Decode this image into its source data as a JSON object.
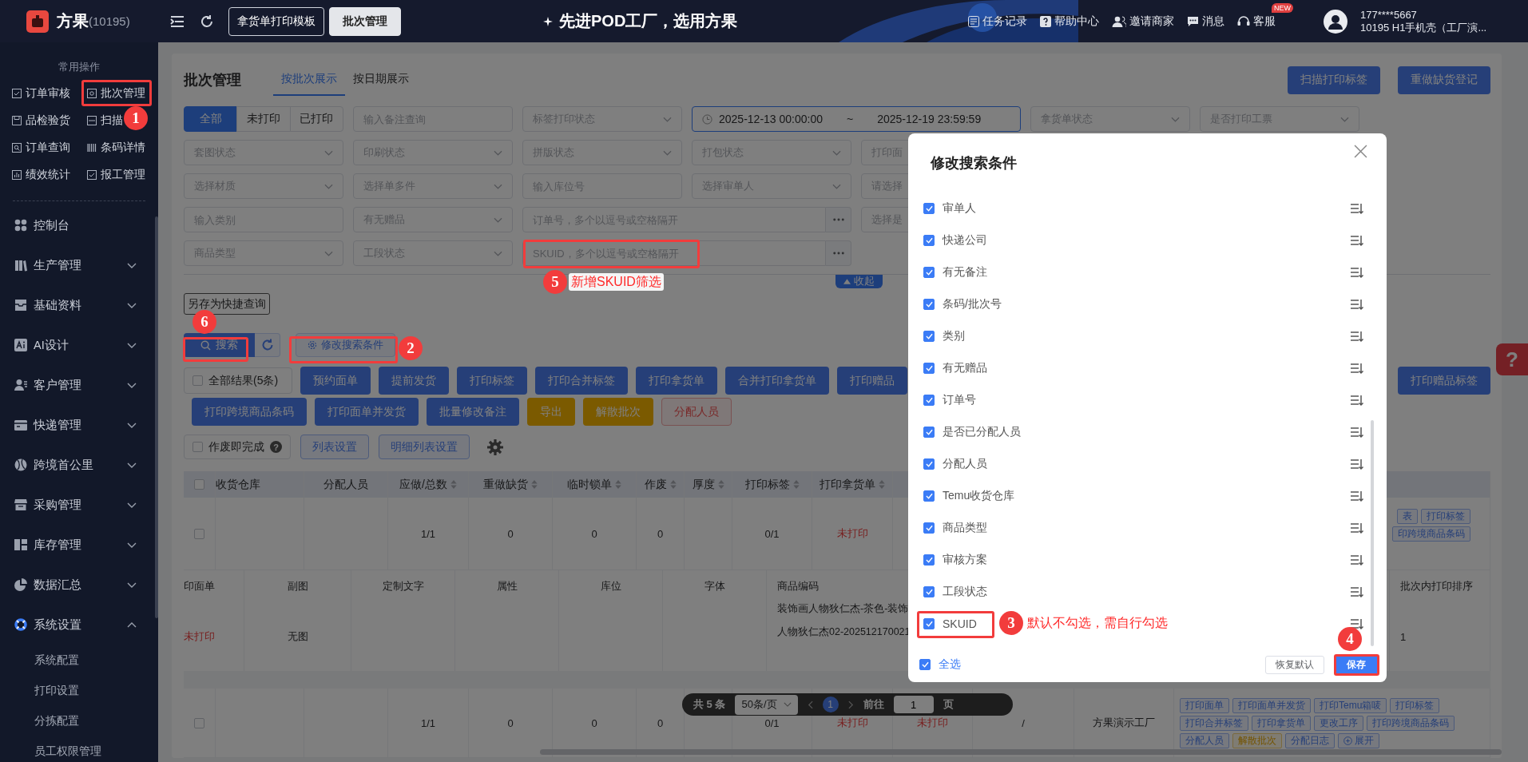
{
  "topbar": {
    "brand": "方果",
    "brand_count": "(10195)",
    "nav_tabs": [
      {
        "label": "拿货单打印模板",
        "selected": false
      },
      {
        "label": "批次管理",
        "selected": true
      }
    ],
    "slogan": "先进POD工厂，选用方果",
    "links": [
      {
        "label": "任务记录"
      },
      {
        "label": "帮助中心"
      },
      {
        "label": "邀请商家"
      },
      {
        "label": "消息"
      },
      {
        "label": "客服",
        "badge": "NEW"
      }
    ],
    "user": {
      "phone": "177****5667",
      "org": "10195  H1手机壳（工厂演..."
    }
  },
  "sidebar": {
    "section_title": "常用操作",
    "quick_items": [
      {
        "label": "订单审核"
      },
      {
        "label": "批次管理"
      },
      {
        "label": "品检验货"
      },
      {
        "label": "扫描"
      },
      {
        "label": "订单查询"
      },
      {
        "label": "条码详情"
      },
      {
        "label": "绩效统计"
      },
      {
        "label": "报工管理"
      }
    ],
    "menu": [
      {
        "label": "控制台",
        "kind": "link"
      },
      {
        "label": "生产管理",
        "kind": "group",
        "expanded": false
      },
      {
        "label": "基础资料",
        "kind": "group",
        "expanded": false
      },
      {
        "label": "AI设计",
        "kind": "group",
        "expanded": false
      },
      {
        "label": "客户管理",
        "kind": "group",
        "expanded": false
      },
      {
        "label": "快递管理",
        "kind": "group",
        "expanded": false
      },
      {
        "label": "跨境首公里",
        "kind": "group",
        "expanded": false
      },
      {
        "label": "采购管理",
        "kind": "group",
        "expanded": false
      },
      {
        "label": "库存管理",
        "kind": "group",
        "expanded": false
      },
      {
        "label": "数据汇总",
        "kind": "group",
        "expanded": false
      },
      {
        "label": "系统设置",
        "kind": "group",
        "expanded": true,
        "children": [
          {
            "label": "系统配置"
          },
          {
            "label": "打印设置"
          },
          {
            "label": "分拣配置"
          },
          {
            "label": "员工权限管理"
          }
        ]
      }
    ]
  },
  "page": {
    "title": "批次管理",
    "view_tabs": [
      {
        "label": "按批次展示",
        "selected": true
      },
      {
        "label": "按日期展示",
        "selected": false
      }
    ],
    "top_actions": [
      "扫描打印标签",
      "重做缺货登记"
    ],
    "filters": [
      {
        "fields": [
          {
            "kind": "segmented",
            "options": [
              {
                "label": "全部",
                "selected": true
              },
              {
                "label": "未打印",
                "selected": false
              },
              {
                "label": "已打印",
                "selected": false
              }
            ]
          },
          {
            "kind": "input",
            "placeholder": "输入备注查询"
          },
          {
            "kind": "select",
            "placeholder": "标签打印状态"
          },
          {
            "kind": "daterange",
            "start": "2025-12-13 00:00:00",
            "separator": "~",
            "end": "2025-12-19 23:59:59"
          },
          {
            "kind": "select",
            "placeholder": "拿货单状态"
          },
          {
            "kind": "select",
            "placeholder": "是否打印工票"
          }
        ]
      },
      {
        "fields": [
          {
            "kind": "select",
            "placeholder": "套图状态"
          },
          {
            "kind": "select",
            "placeholder": "印刷状态"
          },
          {
            "kind": "select",
            "placeholder": "拼版状态"
          },
          {
            "kind": "select",
            "placeholder": "打包状态"
          },
          {
            "kind": "partial",
            "placeholder": "打印面"
          }
        ]
      },
      {
        "fields": [
          {
            "kind": "select",
            "placeholder": "选择材质"
          },
          {
            "kind": "select",
            "placeholder": "选择单多件"
          },
          {
            "kind": "input",
            "placeholder": "输入库位号"
          },
          {
            "kind": "select",
            "placeholder": "选择审单人"
          },
          {
            "kind": "partial",
            "placeholder": "请选择"
          }
        ]
      },
      {
        "fields": [
          {
            "kind": "input",
            "placeholder": "输入类别"
          },
          {
            "kind": "select",
            "placeholder": "有无赠品"
          },
          {
            "kind": "multi",
            "placeholder": "订单号，多个以逗号或空格隔开"
          },
          {
            "kind": "partial",
            "placeholder": "选择是"
          }
        ]
      },
      {
        "fields": [
          {
            "kind": "select",
            "placeholder": "商品类型"
          },
          {
            "kind": "select",
            "placeholder": "工段状态"
          },
          {
            "kind": "multi",
            "placeholder": "SKUID，多个以逗号或空格隔开"
          }
        ]
      }
    ],
    "collapse_label": "收起",
    "save_query": "另存为快捷查询",
    "search_label": "搜索",
    "edit_conditions": "修改搜索条件",
    "bulk": {
      "select_all": {
        "label": "全部结果(5条)",
        "checked": false
      },
      "rows": [
        {
          "buttons": [
            {
              "label": "预约面单",
              "kind": "primary"
            },
            {
              "label": "提前发货",
              "kind": "primary"
            },
            {
              "label": "打印标签",
              "kind": "primary"
            },
            {
              "label": "打印合并标签",
              "kind": "primary"
            },
            {
              "label": "打印拿货单",
              "kind": "primary"
            },
            {
              "label": "合并打印拿货单",
              "kind": "primary"
            },
            {
              "label": "打印赠品",
              "kind": "primary"
            }
          ]
        },
        {
          "buttons": [
            {
              "label": "打印跨境商品条码",
              "kind": "primary"
            },
            {
              "label": "打印面单并发货",
              "kind": "primary"
            },
            {
              "label": "批量修改备注",
              "kind": "primary"
            },
            {
              "label": "导出",
              "kind": "warning"
            },
            {
              "label": "解散批次",
              "kind": "warning"
            },
            {
              "label": "分配人员",
              "kind": "danger"
            }
          ]
        }
      ],
      "right": [
        {
          "label": "打印赠品标签",
          "kind": "primary"
        }
      ]
    },
    "list_options": {
      "void_done": {
        "label": "作废即完成",
        "checked": false,
        "hint": "?"
      },
      "buttons": [
        "列表设置",
        "明细列表设置"
      ]
    },
    "table": {
      "select_all_checked": false,
      "columns": [
        {
          "heading": "收货仓库",
          "sortable": false
        },
        {
          "heading": "分配人员",
          "sortable": false
        },
        {
          "heading": "应做/总数",
          "sortable": true
        },
        {
          "heading": "重做缺货",
          "sortable": true
        },
        {
          "heading": "临时锁单",
          "sortable": true
        },
        {
          "heading": "作废",
          "sortable": true
        },
        {
          "heading": "厚度",
          "sortable": true
        },
        {
          "heading": "打印标签",
          "sortable": true
        },
        {
          "heading": "打印拿货单",
          "sortable": true
        }
      ],
      "rows": [
        {
          "checked": false,
          "cells": [
            null,
            null,
            "1/1",
            "0",
            "0",
            "0",
            null,
            "0/1",
            {
              "text": "未打印",
              "alert": true
            },
            null,
            null,
            null
          ],
          "actions": [
            {
              "buttons": [
                {
                  "label": "表",
                  "kind": "link"
                },
                {
                  "label": "打印标签",
                  "kind": "link"
                }
              ]
            },
            {
              "buttons": [
                {
                  "label": "印跨境商品条码",
                  "kind": "link"
                }
              ]
            }
          ],
          "detail": {
            "columns": [
              "印面单",
              "副图",
              "定制文字",
              "属性",
              "库位",
              "字体",
              "商品编码",
              "批次内打印排序"
            ],
            "print_status": "未打印",
            "sub_image": "无图",
            "product_code": [
              "装饰画人物狄仁杰-茶色-装饰",
              "人物狄仁杰02-202512170021"
            ],
            "print_order": "1"
          }
        },
        {
          "checked": false,
          "cells": [
            null,
            null,
            "1/1",
            "0",
            "0",
            "0",
            null,
            "0/1",
            {
              "text": "未打印",
              "alert": true
            },
            {
              "text": "未打印",
              "alert": true
            },
            "/",
            "方果演示工厂"
          ],
          "actions": [
            {
              "buttons": [
                {
                  "label": "打印面单",
                  "kind": "link"
                },
                {
                  "label": "打印面单并发货",
                  "kind": "link"
                },
                {
                  "label": "打印Temu箱唛",
                  "kind": "link"
                },
                {
                  "label": "打印标签",
                  "kind": "link"
                }
              ]
            },
            {
              "buttons": [
                {
                  "label": "打印合并标签",
                  "kind": "link"
                },
                {
                  "label": "打印拿货单",
                  "kind": "link"
                },
                {
                  "label": "更改工序",
                  "kind": "link"
                },
                {
                  "label": "打印跨境商品条码",
                  "kind": "link"
                }
              ]
            },
            {
              "buttons": [
                {
                  "label": "分配人员",
                  "kind": "link"
                },
                {
                  "label": "解散批次",
                  "kind": "warning"
                },
                {
                  "label": "分配日志",
                  "kind": "link"
                },
                {
                  "label": "展开",
                  "kind": "expand"
                }
              ]
            }
          ]
        }
      ]
    },
    "pagination": {
      "total": "共 5 条",
      "page_size": "50条/页",
      "pages": [
        {
          "label": "1",
          "selected": true
        }
      ],
      "goto_label": "前往",
      "goto_value": "1",
      "goto_suffix": "页"
    },
    "help_tab": "?"
  },
  "modal": {
    "title": "修改搜索条件",
    "items": [
      {
        "label": "审单人",
        "checked": true
      },
      {
        "label": "快递公司",
        "checked": true
      },
      {
        "label": "有无备注",
        "checked": true
      },
      {
        "label": "条码/批次号",
        "checked": true
      },
      {
        "label": "类别",
        "checked": true
      },
      {
        "label": "有无赠品",
        "checked": true
      },
      {
        "label": "订单号",
        "checked": true
      },
      {
        "label": "是否已分配人员",
        "checked": true
      },
      {
        "label": "分配人员",
        "checked": true
      },
      {
        "label": "Temu收货仓库",
        "checked": true
      },
      {
        "label": "商品类型",
        "checked": true
      },
      {
        "label": "审核方案",
        "checked": true
      },
      {
        "label": "工段状态",
        "checked": true
      },
      {
        "label": "SKUID",
        "checked": true
      }
    ],
    "select_all": {
      "label": "全选",
      "checked": true
    },
    "buttons": [
      {
        "label": "恢复默认",
        "kind": "default"
      },
      {
        "label": "保存",
        "kind": "primary"
      }
    ]
  },
  "annotations": [
    {
      "number": "1"
    },
    {
      "number": "2"
    },
    {
      "number": "3",
      "note": "默认不勾选，需自行勾选"
    },
    {
      "number": "4"
    },
    {
      "number": "5",
      "note": "新增SKUID筛选"
    },
    {
      "number": "6"
    }
  ]
}
